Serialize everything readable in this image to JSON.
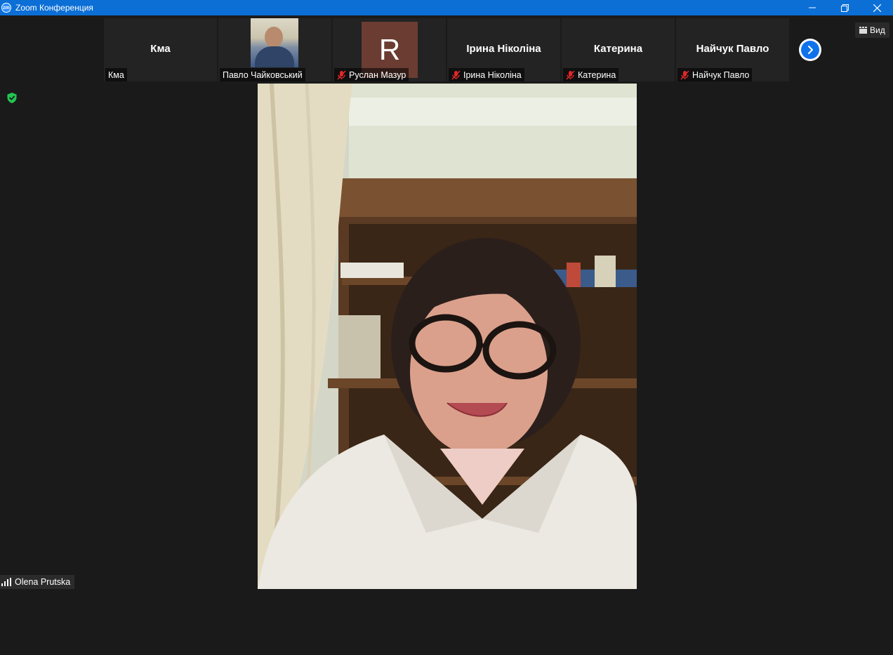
{
  "window": {
    "title": "Zoom Конференция",
    "logo_text": "zm"
  },
  "view_button": {
    "label": "Вид"
  },
  "participants": [
    {
      "center_name": "Кма",
      "label": "Кма",
      "muted": false,
      "avatar": "none"
    },
    {
      "center_name": "",
      "label": "Павло Чайковський",
      "muted": false,
      "avatar": "photo"
    },
    {
      "center_name": "",
      "label": "Руслан Мазур",
      "muted": true,
      "avatar": "letter",
      "letter": "R"
    },
    {
      "center_name": "Ірина Ніколіна",
      "label": "Ірина Ніколіна",
      "muted": true,
      "avatar": "none"
    },
    {
      "center_name": "Катерина",
      "label": "Катерина",
      "muted": true,
      "avatar": "none"
    },
    {
      "center_name": "Найчук Павло",
      "label": "Найчук Павло",
      "muted": true,
      "avatar": "none"
    }
  ],
  "active_speaker": {
    "name": "Olena Prutska",
    "icon": "signal-bars-icon"
  },
  "colors": {
    "titlebar": "#0b6fd6",
    "background": "#1a1a1a",
    "tile": "#232323",
    "accent_blue": "#0e72ed",
    "mute_red": "#e02828",
    "shield_green": "#23c552"
  }
}
